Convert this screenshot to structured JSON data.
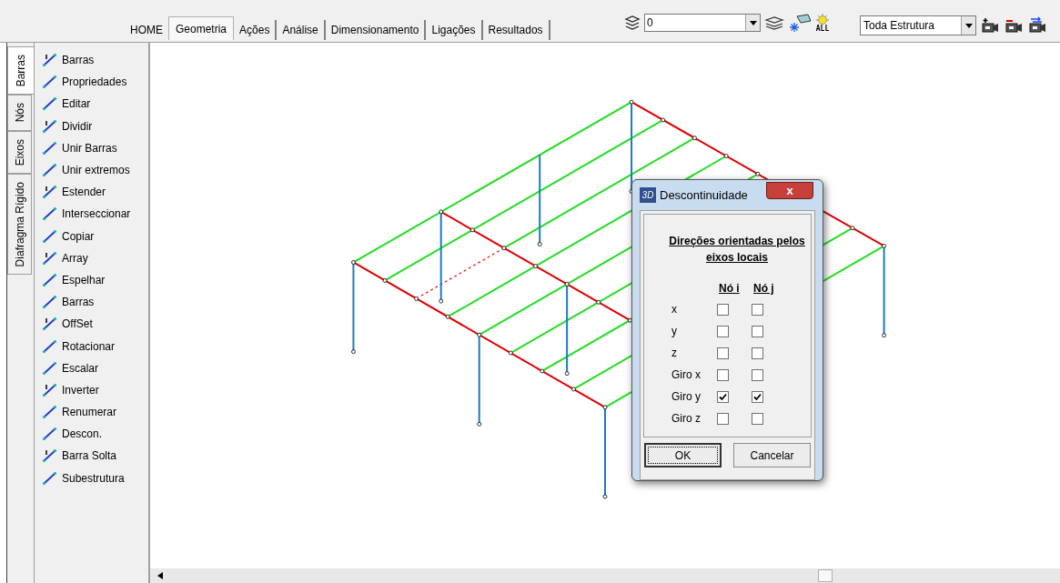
{
  "top_tabs": [
    {
      "label": "HOME",
      "selected": false
    },
    {
      "label": "Geometria",
      "selected": true
    },
    {
      "label": "Ações",
      "selected": false
    },
    {
      "label": "Análise",
      "selected": false
    },
    {
      "label": "Dimensionamento",
      "selected": false
    },
    {
      "label": "Ligações",
      "selected": false
    },
    {
      "label": "Resultados",
      "selected": false
    }
  ],
  "layer_combo": {
    "value": "0"
  },
  "sun_icon_label": "ALL",
  "structure_combo": {
    "value": "Toda Estrutura"
  },
  "side_tabs": [
    {
      "label": "Barras",
      "selected": true
    },
    {
      "label": "Nós",
      "selected": false
    },
    {
      "label": "Eixos",
      "selected": false
    },
    {
      "label": "Diafragma Rígido",
      "selected": false
    }
  ],
  "tools": [
    "Barras",
    "Propriedades",
    "Editar",
    "Dividir",
    "Unir Barras",
    "Unir extremos",
    "Estender",
    "Interseccionar",
    "Copiar",
    "Array",
    "Espelhar",
    "Barras",
    "OffSet",
    "Rotacionar",
    "Escalar",
    "Inverter",
    "Renumerar",
    "Descon.",
    "Barra Solta",
    "Subestrutura"
  ],
  "dialog": {
    "icon_text": "3D",
    "title": "Descontinuidade",
    "close": "x",
    "heading": "Direções orientadas pelos eixos locais",
    "columns": [
      "Nó i",
      "Nó j"
    ],
    "rows": [
      {
        "label": "x",
        "node_i": false,
        "node_j": false
      },
      {
        "label": "y",
        "node_i": false,
        "node_j": false
      },
      {
        "label": "z",
        "node_i": false,
        "node_j": false
      },
      {
        "label": "Giro x",
        "node_i": false,
        "node_j": false
      },
      {
        "label": "Giro y",
        "node_i": true,
        "node_j": true
      },
      {
        "label": "Giro z",
        "node_i": false,
        "node_j": false
      }
    ],
    "buttons": [
      {
        "label": "OK",
        "default": true
      },
      {
        "label": "Cancelar",
        "default": false
      }
    ]
  }
}
